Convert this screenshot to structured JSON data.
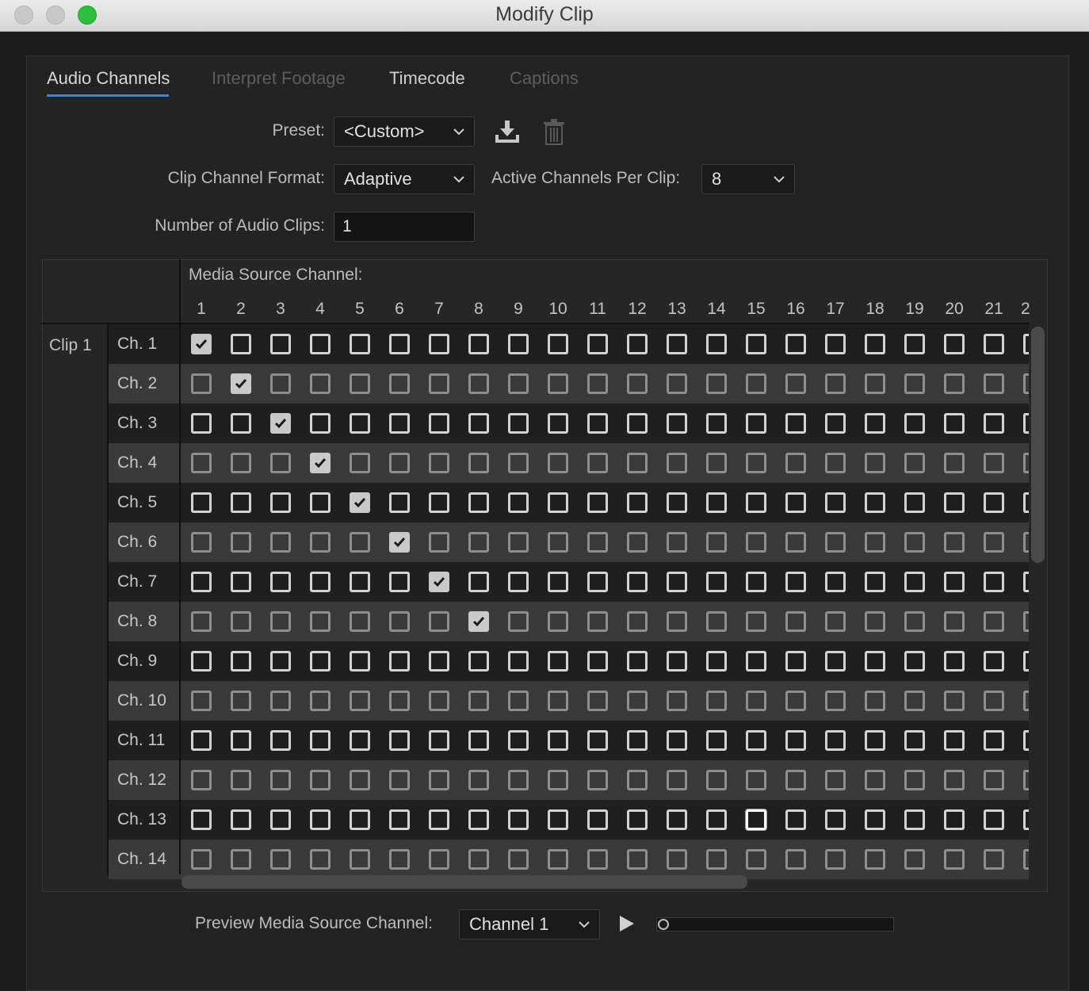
{
  "window": {
    "title": "Modify Clip"
  },
  "tabs": [
    {
      "label": "Audio Channels",
      "state": "active"
    },
    {
      "label": "Interpret Footage",
      "state": "disabled"
    },
    {
      "label": "Timecode",
      "state": "normal"
    },
    {
      "label": "Captions",
      "state": "disabled"
    }
  ],
  "preset": {
    "label": "Preset:",
    "value": "<Custom>"
  },
  "clip_channel_format": {
    "label": "Clip Channel Format:",
    "value": "Adaptive"
  },
  "active_channels": {
    "label": "Active Channels Per Clip:",
    "value": "8"
  },
  "num_audio_clips": {
    "label": "Number of Audio Clips:",
    "value": "1"
  },
  "matrix": {
    "header": "Media Source Channel:",
    "columns": [
      "1",
      "2",
      "3",
      "4",
      "5",
      "6",
      "7",
      "8",
      "9",
      "10",
      "11",
      "12",
      "13",
      "14",
      "15",
      "16",
      "17",
      "18",
      "19",
      "20",
      "21",
      "2"
    ],
    "clip_label": "Clip 1",
    "rows": [
      {
        "label": "Ch. 1",
        "checked": 1
      },
      {
        "label": "Ch. 2",
        "checked": 2
      },
      {
        "label": "Ch. 3",
        "checked": 3
      },
      {
        "label": "Ch. 4",
        "checked": 4
      },
      {
        "label": "Ch. 5",
        "checked": 5
      },
      {
        "label": "Ch. 6",
        "checked": 6
      },
      {
        "label": "Ch. 7",
        "checked": 7
      },
      {
        "label": "Ch. 8",
        "checked": 8
      },
      {
        "label": "Ch. 9",
        "checked": 0
      },
      {
        "label": "Ch. 10",
        "checked": 0
      },
      {
        "label": "Ch. 11",
        "checked": 0
      },
      {
        "label": "Ch. 12",
        "checked": 0
      },
      {
        "label": "Ch. 13",
        "checked": 0,
        "focused": 15
      },
      {
        "label": "Ch. 14",
        "checked": 0
      }
    ]
  },
  "preview": {
    "label": "Preview Media Source Channel:",
    "value": "Channel 1",
    "position": 0
  },
  "colors": {
    "accent": "#2d8ceb",
    "background": "#232323"
  }
}
